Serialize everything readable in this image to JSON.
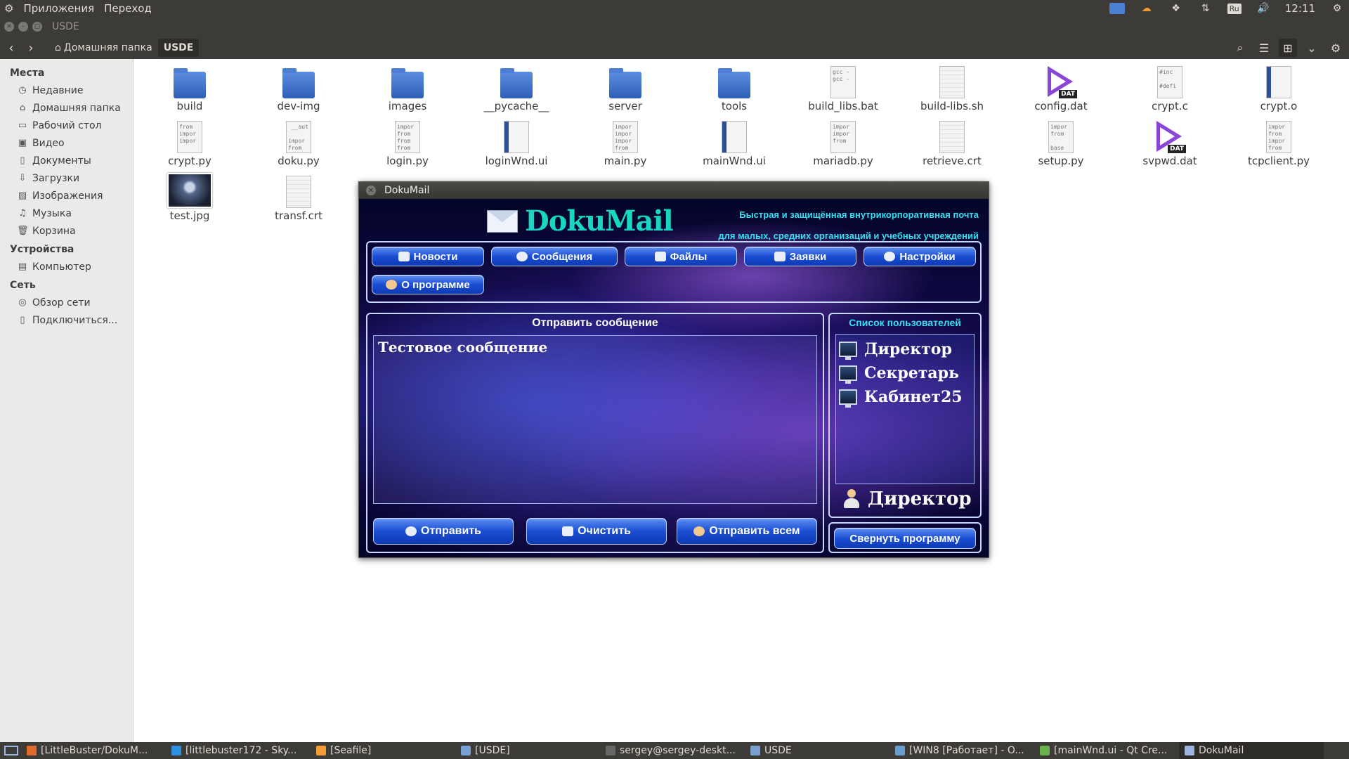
{
  "top_panel": {
    "menu": [
      "Приложения",
      "Переход"
    ],
    "lang": "Ru",
    "clock": "12:11"
  },
  "window": {
    "title": "USDE"
  },
  "toolbar": {
    "breadcrumb": [
      "Домашняя папка",
      "USDE"
    ]
  },
  "sidebar": {
    "sections": [
      {
        "title": "Места",
        "items": [
          {
            "label": "Недавние",
            "icon": "clock-icon"
          },
          {
            "label": "Домашняя папка",
            "icon": "home-icon"
          },
          {
            "label": "Рабочий стол",
            "icon": "desktop-icon"
          },
          {
            "label": "Видео",
            "icon": "video-icon"
          },
          {
            "label": "Документы",
            "icon": "document-icon"
          },
          {
            "label": "Загрузки",
            "icon": "download-icon"
          },
          {
            "label": "Изображения",
            "icon": "image-icon"
          },
          {
            "label": "Музыка",
            "icon": "music-icon"
          },
          {
            "label": "Корзина",
            "icon": "trash-icon"
          }
        ]
      },
      {
        "title": "Устройства",
        "items": [
          {
            "label": "Компьютер",
            "icon": "computer-icon"
          }
        ]
      },
      {
        "title": "Сеть",
        "items": [
          {
            "label": "Обзор сети",
            "icon": "network-icon"
          },
          {
            "label": "Подключиться...",
            "icon": "connect-icon"
          }
        ]
      }
    ]
  },
  "files": [
    {
      "name": "build",
      "type": "folder"
    },
    {
      "name": "dev-img",
      "type": "folder"
    },
    {
      "name": "images",
      "type": "folder"
    },
    {
      "name": "__pycache__",
      "type": "folder"
    },
    {
      "name": "server",
      "type": "folder"
    },
    {
      "name": "tools",
      "type": "folder"
    },
    {
      "name": "build_libs.bat",
      "type": "text",
      "preview": "gcc -\ngcc -"
    },
    {
      "name": "build-libs.sh",
      "type": "lines"
    },
    {
      "name": "config.dat",
      "type": "dat",
      "badge": "DAT"
    },
    {
      "name": "crypt.c",
      "type": "text",
      "preview": "#inc\n\n#defi"
    },
    {
      "name": "crypt.o",
      "type": "blue"
    },
    {
      "name": "crypt.py",
      "type": "text",
      "preview": "from\nimpor\nimpor"
    },
    {
      "name": "doku.py",
      "type": "text",
      "preview": " __aut\n\nimpor\nfrom"
    },
    {
      "name": "login.py",
      "type": "text",
      "preview": "impor\nfrom\nfrom\nfrom"
    },
    {
      "name": "loginWnd.ui",
      "type": "blue"
    },
    {
      "name": "main.py",
      "type": "text",
      "preview": "impor\nimpor\nimpor\nfrom"
    },
    {
      "name": "mainWnd.ui",
      "type": "blue"
    },
    {
      "name": "mariadb.py",
      "type": "text",
      "preview": "impor\nimpor\nfrom"
    },
    {
      "name": "retrieve.crt",
      "type": "lines"
    },
    {
      "name": "setup.py",
      "type": "text",
      "preview": "impor\nfrom\n\nbase"
    },
    {
      "name": "svpwd.dat",
      "type": "dat",
      "badge": "DAT"
    },
    {
      "name": "tcpclient.py",
      "type": "text",
      "preview": "impor\nfrom\nimpor\nfrom"
    },
    {
      "name": "test.jpg",
      "type": "image"
    },
    {
      "name": "transf.crt",
      "type": "lines"
    }
  ],
  "dokumail": {
    "title": "DokuMail",
    "logo": "DokuMail",
    "slogan_line1": "Быстрая и защищённая внутрикорпоративная почта",
    "slogan_line2": "для малых, средних организаций и учебных учреждений",
    "nav": {
      "news": "Новости",
      "messages": "Сообщения",
      "files": "Файлы",
      "requests": "Заявки",
      "settings": "Настройки",
      "about": "О программе"
    },
    "send_panel_title": "Отправить сообщение",
    "message_text": "Тестовое сообщение",
    "send": "Отправить",
    "clear": "Очистить",
    "send_all": "Отправить всем",
    "users_title": "Список пользователей",
    "users": [
      "Директор",
      "Секретарь",
      "Кабинет25"
    ],
    "current_user": "Директор",
    "minimize": "Свернуть программу"
  },
  "taskbar": [
    {
      "label": "[LittleBuster/DokuM...",
      "active": false
    },
    {
      "label": "[littlebuster172 - Sky...",
      "active": false
    },
    {
      "label": "[Seafile]",
      "active": false
    },
    {
      "label": "[USDE]",
      "active": false
    },
    {
      "label": "sergey@sergey-deskt...",
      "active": false
    },
    {
      "label": "USDE",
      "active": false
    },
    {
      "label": "[WIN8 [Работает] - O...",
      "active": false
    },
    {
      "label": "[mainWnd.ui - Qt Cre...",
      "active": false
    },
    {
      "label": "DokuMail",
      "active": true
    }
  ]
}
